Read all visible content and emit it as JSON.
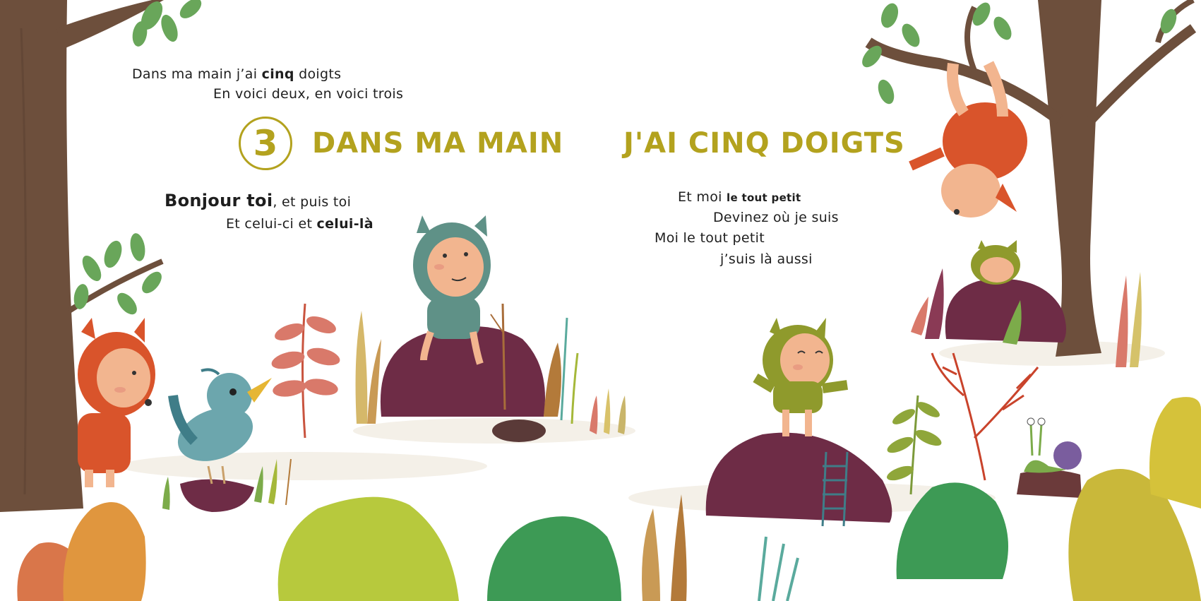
{
  "song": {
    "number": "3",
    "title_left": "DANS MA MAIN",
    "title_right": "J'AI CINQ DOIGTS",
    "intro_1_a": "Dans ma main j’ai ",
    "intro_1_b": "cinq",
    "intro_1_c": " doigts",
    "intro_2": "En voici deux, en voici trois",
    "verse_1_a": "Bonjour toi",
    "verse_1_b": ", et puis toi",
    "verse_2_a": "Et celui-ci et ",
    "verse_2_b": "celui-là",
    "verse_3_a": "Et moi ",
    "verse_3_b": "le tout petit",
    "verse_4": "Devinez où je suis",
    "verse_5": "Moi le tout petit",
    "verse_6": "j’suis là aussi"
  },
  "colors": {
    "title_olive": "#b3a21e",
    "text": "#1e1e1e",
    "trunk": "#6d4f3c",
    "leaf_green": "#69a65a",
    "hill_plum": "#6e2c46",
    "teal_hood": "#5f9187",
    "olive_hood": "#8f9a2c",
    "fox_orange": "#d9542b",
    "bird_blue": "#6ca6ad",
    "bush_lime": "#b7c93d",
    "bush_green": "#3d9a55",
    "skin": "#f2b58f"
  }
}
